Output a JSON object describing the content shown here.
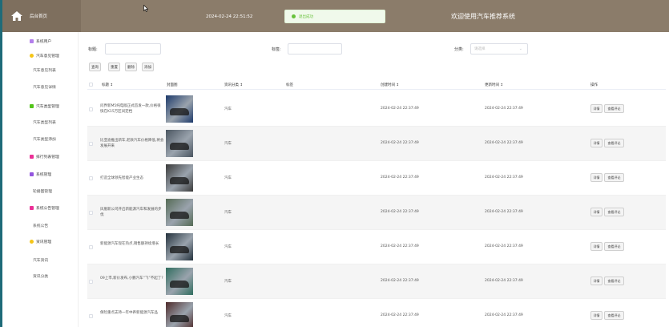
{
  "header": {
    "logo_text": "后台首页",
    "datetime": "2024-02-24 22:51:52",
    "toast": "退出成功",
    "welcome": "欢迎使用汽车推荐系统",
    "bg_color": "#8b7c6a"
  },
  "sidebar": {
    "items": [
      {
        "label": "系统用户",
        "type": "group",
        "icon_color": "#b37feb",
        "icon": "user-icon"
      },
      {
        "label": "汽车意见管理",
        "type": "group",
        "icon_color": "#f5c518",
        "icon": "circle-icon"
      },
      {
        "label": "汽车意见列表",
        "type": "sub"
      },
      {
        "label": "汽车意见详情",
        "type": "sub"
      },
      {
        "label": "汽车类型管理",
        "type": "group",
        "icon_color": "#52c41a",
        "icon": "list-icon"
      },
      {
        "label": "汽车类型列表",
        "type": "sub"
      },
      {
        "label": "汽车类型添加",
        "type": "sub"
      },
      {
        "label": "排行列表管理",
        "type": "group",
        "icon_color": "#eb2f96",
        "icon": "rank-icon"
      },
      {
        "label": "系统管理",
        "type": "group",
        "icon_color": "#9254de",
        "icon": "settings-icon"
      },
      {
        "label": "轮播图管理",
        "type": "sub"
      },
      {
        "label": "系统公告管理",
        "type": "group",
        "icon_color": "#eb2f96",
        "icon": "notice-icon"
      },
      {
        "label": "系统公告",
        "type": "sub"
      },
      {
        "label": "资讯管理",
        "type": "group",
        "icon_color": "#f5c518",
        "icon": "news-icon"
      },
      {
        "label": "汽车资讯",
        "type": "sub"
      },
      {
        "label": "资讯分类",
        "type": "sub"
      }
    ]
  },
  "search": {
    "title_label": "标题:",
    "title_placeholder": "",
    "tag_label": "标签:",
    "tag_placeholder": "",
    "category_label": "分类:",
    "category_placeholder": "请选择"
  },
  "toolbar": {
    "query": "查询",
    "reset": "重置",
    "delete": "删除",
    "add": "添加"
  },
  "table": {
    "columns": [
      "标题 ↕",
      "封面图",
      "资讯分类 ↕",
      "标签",
      "创建时间 ↕",
      "更新时间 ↕",
      "操作"
    ],
    "rows": [
      {
        "title": "问界新M5纯电版正式首发一款,价格很快在K15万区间定档",
        "category": "汽车",
        "created": "2024-02-24 22:37:49",
        "updated": "2024-02-24 22:37:49",
        "edit": "详情",
        "view": "查看评论"
      },
      {
        "title": "比亚迪推出新车,老款汽车价格降低,将会发展开来",
        "category": "汽车",
        "created": "2024-02-24 22:37:49",
        "updated": "2024-02-24 22:37:49",
        "edit": "详情",
        "view": "查看评论"
      },
      {
        "title": "打造全球领先智能产业生态",
        "category": "汽车",
        "created": "2024-02-24 22:37:49",
        "updated": "2024-02-24 22:37:49",
        "edit": "详情",
        "view": "查看评论"
      },
      {
        "title": "凤凰新公司开启新能源汽车和发展的步伐",
        "category": "汽车",
        "created": "2024-02-24 22:37:49",
        "updated": "2024-02-24 22:37:49",
        "edit": "详情",
        "view": "查看评论"
      },
      {
        "title": "新能源汽车现在热点,销售额持续增长",
        "category": "汽车",
        "created": "2024-02-24 22:37:49",
        "updated": "2024-02-24 22:37:49",
        "edit": "详情",
        "view": "查看评论"
      },
      {
        "title": "09上市,新价发布,小鹏汽车“飞”不起了?",
        "category": "汽车",
        "created": "2024-02-24 22:37:49",
        "updated": "2024-02-24 22:37:49",
        "edit": "详情",
        "view": "查看评论"
      },
      {
        "title": "保险重点支持一年中养新能源汽车品",
        "category": "汽车",
        "created": "2024-02-24 22:37:49",
        "updated": "2024-02-24 22:37:49",
        "edit": "详情",
        "view": "查看评论"
      }
    ]
  },
  "thumb_colors": [
    "#1d3a6b",
    "#4a5560",
    "#3a3a3a",
    "#556b55",
    "#24323d",
    "#2f6d5e",
    "#4e2a2a"
  ]
}
